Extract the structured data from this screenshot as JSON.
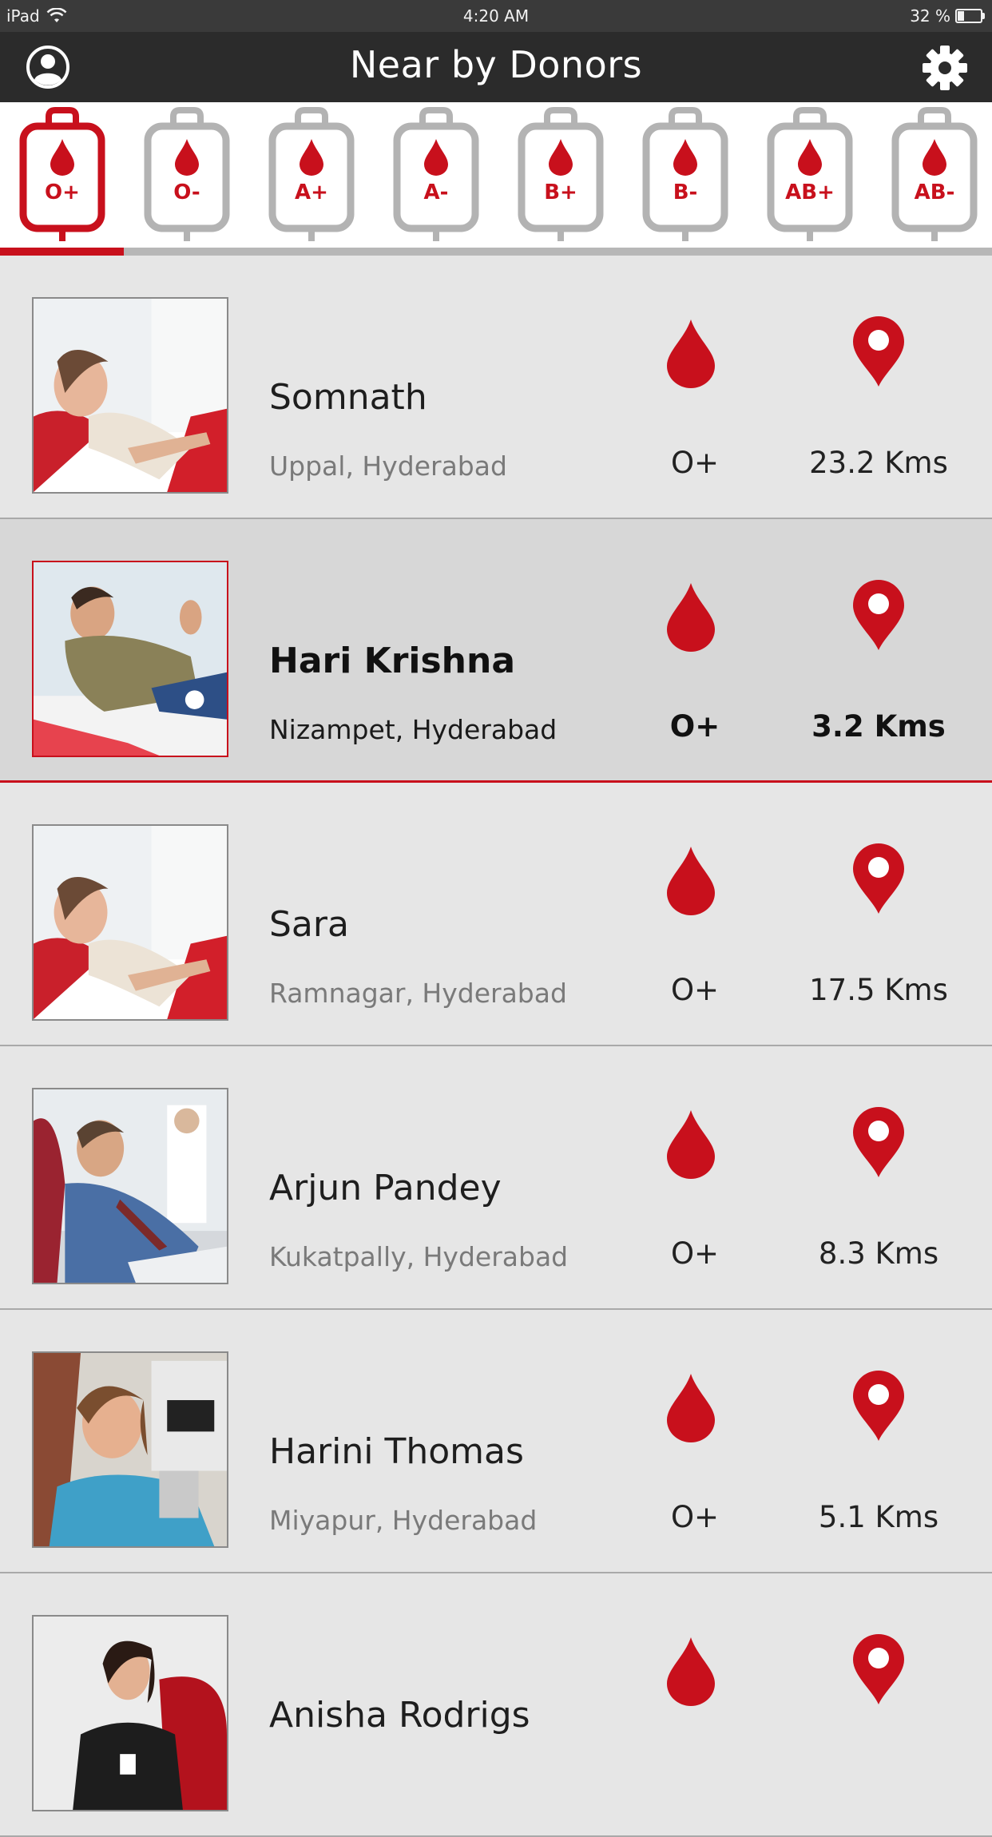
{
  "status_bar": {
    "device": "iPad",
    "time": "4:20 AM",
    "battery": "32 %",
    "battery_level": 0.32
  },
  "nav": {
    "title": "Near by Donors",
    "left_icon": "profile-icon",
    "right_icon": "gear-icon"
  },
  "blood_types": [
    "O+",
    "O-",
    "A+",
    "A-",
    "B+",
    "B-",
    "AB+",
    "AB-"
  ],
  "selected_blood_type_index": 0,
  "colors": {
    "accent": "#c8101c",
    "inactive": "#b3b3b3",
    "header": "#2b2b2b"
  },
  "donors": [
    {
      "name": "Somnath",
      "location": "Uppal, Hyderabad",
      "blood_group": "O+",
      "distance": "23.2 Kms",
      "selected": false
    },
    {
      "name": "Hari Krishna",
      "location": "Nizampet, Hyderabad",
      "blood_group": "O+",
      "distance": "3.2 Kms",
      "selected": true
    },
    {
      "name": "Sara",
      "location": "Ramnagar, Hyderabad",
      "blood_group": "O+",
      "distance": "17.5 Kms",
      "selected": false
    },
    {
      "name": "Arjun Pandey",
      "location": "Kukatpally, Hyderabad",
      "blood_group": "O+",
      "distance": "8.3 Kms",
      "selected": false
    },
    {
      "name": "Harini Thomas",
      "location": "Miyapur, Hyderabad",
      "blood_group": "O+",
      "distance": "5.1 Kms",
      "selected": false
    },
    {
      "name": "Anisha Rodrigs",
      "location": "",
      "blood_group": "",
      "distance": "",
      "selected": false
    }
  ]
}
